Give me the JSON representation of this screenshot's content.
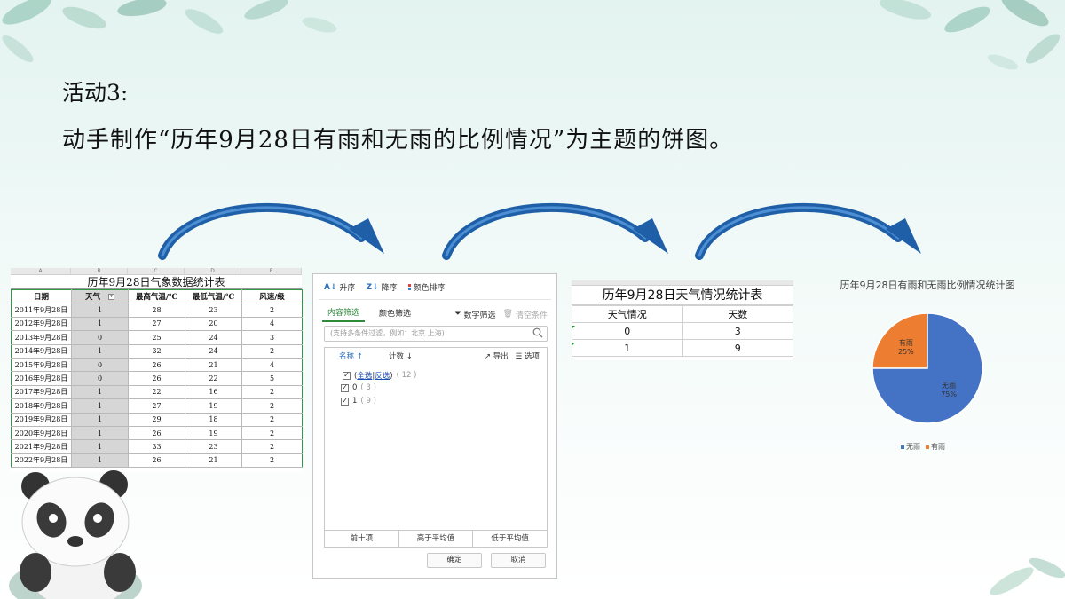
{
  "slide": {
    "heading": "活动3:",
    "task": "动手制作“历年9月28日有雨和无雨的比例情况”为主题的饼图。"
  },
  "sheet1": {
    "title": "历年9月28日气象数据统计表",
    "col_letters": [
      "A",
      "B",
      "C",
      "D",
      "E"
    ],
    "headers": [
      "日期",
      "天气",
      "最高气温/℃",
      "最低气温/℃",
      "风速/级"
    ],
    "rows": [
      [
        "2011年9月28日",
        "1",
        "28",
        "23",
        "2"
      ],
      [
        "2012年9月28日",
        "1",
        "27",
        "20",
        "4"
      ],
      [
        "2013年9月28日",
        "0",
        "25",
        "24",
        "3"
      ],
      [
        "2014年9月28日",
        "1",
        "32",
        "24",
        "2"
      ],
      [
        "2015年9月28日",
        "0",
        "26",
        "21",
        "4"
      ],
      [
        "2016年9月28日",
        "0",
        "26",
        "22",
        "5"
      ],
      [
        "2017年9月28日",
        "1",
        "22",
        "16",
        "2"
      ],
      [
        "2018年9月28日",
        "1",
        "27",
        "19",
        "2"
      ],
      [
        "2019年9月28日",
        "1",
        "29",
        "18",
        "2"
      ],
      [
        "2020年9月28日",
        "1",
        "26",
        "19",
        "2"
      ],
      [
        "2021年9月28日",
        "1",
        "33",
        "23",
        "2"
      ],
      [
        "2022年9月28日",
        "1",
        "26",
        "21",
        "2"
      ]
    ]
  },
  "filter": {
    "sort_asc": "升序",
    "sort_desc": "降序",
    "sort_color": "颜色排序",
    "tab_content": "内容筛选",
    "tab_color": "颜色筛选",
    "number_filter": "数字筛选",
    "clear": "清空条件",
    "search_placeholder": "(支持多条件过滤，例如：北京 上海)",
    "col_name": "名称",
    "col_count": "计数",
    "export": "导出",
    "options": "选项",
    "select_all": "全选",
    "invert": "反选",
    "items": [
      {
        "label": "0",
        "count": "3"
      },
      {
        "label": "1",
        "count": "9"
      }
    ],
    "total": "12",
    "top10": "前十项",
    "above_avg": "高于平均值",
    "below_avg": "低于平均值",
    "ok": "确定",
    "cancel": "取消"
  },
  "sheet2": {
    "title": "历年9月28日天气情况统计表",
    "headers": [
      "天气情况",
      "天数"
    ],
    "rows": [
      [
        "0",
        "3"
      ],
      [
        "1",
        "9"
      ]
    ]
  },
  "chart_data": {
    "type": "pie",
    "title": "历年9月28日有雨和无雨比例情况统计图",
    "slices": [
      {
        "name": "无雨",
        "value": 9,
        "label": "75%",
        "color": "#4472c4"
      },
      {
        "name": "有雨",
        "value": 3,
        "label": "25%",
        "color": "#ed7d31"
      }
    ],
    "legend": [
      "无雨",
      "有雨"
    ],
    "legend_placement": "bottom"
  }
}
